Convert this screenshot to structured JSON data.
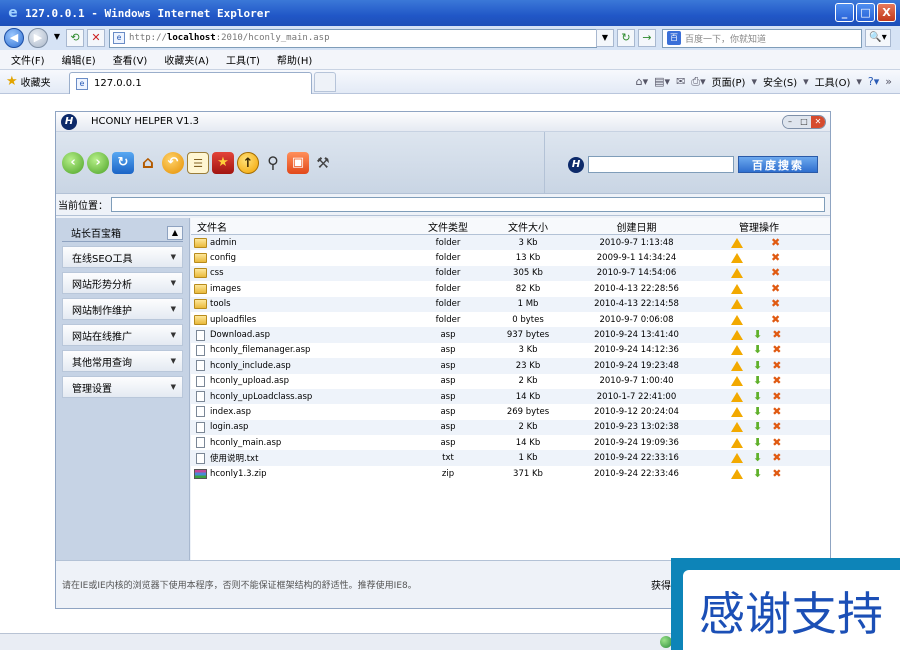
{
  "window": {
    "title": "127.0.0.1 - Windows Internet Explorer",
    "min": "_",
    "max": "□",
    "close": "X"
  },
  "address": {
    "url_prefix": "http://",
    "url_host": "localhost",
    "url_rest": ":2010/hconly_main.asp",
    "search_placeholder": "百度一下，你就知道"
  },
  "menu": [
    "文件(F)",
    "编辑(E)",
    "查看(V)",
    "收藏夹(A)",
    "工具(T)",
    "帮助(H)"
  ],
  "favbar": {
    "favorites_label": "收藏夹",
    "tab_title": "127.0.0.1",
    "cmd_page": "页面(P)",
    "cmd_safety": "安全(S)",
    "cmd_tools": "工具(O)"
  },
  "app": {
    "title": "HCONLY HELPER V1.3",
    "search_button": "百度搜索",
    "location_label": "当前位置：",
    "footer_note": "请在IE或IE内核的浏览器下使用本程序，否则不能保证框架结构的舒适性。推荐使用IE8。",
    "footer_right": "获得"
  },
  "sidebar": {
    "title": "站长百宝箱",
    "items": [
      "在线SEO工具",
      "网站形势分析",
      "网站制作维护",
      "网站在线推广",
      "其他常用查询",
      "管理设置"
    ]
  },
  "files": {
    "headers": {
      "name": "文件名",
      "type": "文件类型",
      "size": "文件大小",
      "date": "创建日期",
      "actions": "管理操作"
    },
    "rows": [
      {
        "name": "admin",
        "type": "folder",
        "size": "3 Kb",
        "date": "2010-9-7 1:13:48",
        "kind": "folder",
        "download": false
      },
      {
        "name": "config",
        "type": "folder",
        "size": "13 Kb",
        "date": "2009-9-1 14:34:24",
        "kind": "folder",
        "download": false
      },
      {
        "name": "css",
        "type": "folder",
        "size": "305 Kb",
        "date": "2010-9-7 14:54:06",
        "kind": "folder",
        "download": false
      },
      {
        "name": "images",
        "type": "folder",
        "size": "82 Kb",
        "date": "2010-4-13 22:28:56",
        "kind": "folder",
        "download": false
      },
      {
        "name": "tools",
        "type": "folder",
        "size": "1 Mb",
        "date": "2010-4-13 22:14:58",
        "kind": "folder",
        "download": false
      },
      {
        "name": "uploadfiles",
        "type": "folder",
        "size": "0 bytes",
        "date": "2010-9-7 0:06:08",
        "kind": "folder",
        "download": false
      },
      {
        "name": "Download.asp",
        "type": "asp",
        "size": "937 bytes",
        "date": "2010-9-24 13:41:40",
        "kind": "doc",
        "download": true
      },
      {
        "name": "hconly_filemanager.asp",
        "type": "asp",
        "size": "3 Kb",
        "date": "2010-9-24 14:12:36",
        "kind": "doc",
        "download": true
      },
      {
        "name": "hconly_include.asp",
        "type": "asp",
        "size": "23 Kb",
        "date": "2010-9-24 19:23:48",
        "kind": "doc",
        "download": true
      },
      {
        "name": "hconly_upload.asp",
        "type": "asp",
        "size": "2 Kb",
        "date": "2010-9-7 1:00:40",
        "kind": "doc",
        "download": true
      },
      {
        "name": "hconly_upLoadclass.asp",
        "type": "asp",
        "size": "14 Kb",
        "date": "2010-1-7 22:41:00",
        "kind": "doc",
        "download": true
      },
      {
        "name": "index.asp",
        "type": "asp",
        "size": "269 bytes",
        "date": "2010-9-12 20:24:04",
        "kind": "doc",
        "download": true
      },
      {
        "name": "login.asp",
        "type": "asp",
        "size": "2 Kb",
        "date": "2010-9-23 13:02:38",
        "kind": "doc",
        "download": true
      },
      {
        "name": "hconly_main.asp",
        "type": "asp",
        "size": "14 Kb",
        "date": "2010-9-24 19:09:36",
        "kind": "doc",
        "download": true
      },
      {
        "name": "使用说明.txt",
        "type": "txt",
        "size": "1 Kb",
        "date": "2010-9-24 22:33:16",
        "kind": "doc",
        "download": true
      },
      {
        "name": "hconly1.3.zip",
        "type": "zip",
        "size": "371 Kb",
        "date": "2010-9-24 22:33:46",
        "kind": "zip",
        "download": true
      }
    ]
  },
  "overlay": {
    "text": "感谢支持"
  }
}
